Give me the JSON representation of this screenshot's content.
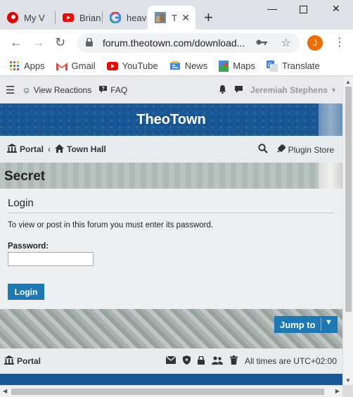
{
  "browser": {
    "tabs": [
      {
        "title": "My V",
        "icon": "vodafone-icon"
      },
      {
        "title": "Brian",
        "icon": "youtube-icon"
      },
      {
        "title": "heav",
        "icon": "google-icon"
      },
      {
        "title": "T",
        "icon": "theotown-icon",
        "active": true
      }
    ],
    "new_tab": "+",
    "url": "forum.theotown.com/download...",
    "profile_initial": "J",
    "bookmarks": [
      {
        "label": "Apps",
        "icon": "apps-grid-icon"
      },
      {
        "label": "Gmail",
        "icon": "gmail-icon"
      },
      {
        "label": "YouTube",
        "icon": "youtube-icon"
      },
      {
        "label": "News",
        "icon": "google-news-icon"
      },
      {
        "label": "Maps",
        "icon": "google-maps-icon"
      },
      {
        "label": "Translate",
        "icon": "google-translate-icon"
      }
    ]
  },
  "forum": {
    "nav": {
      "view_reactions": "View Reactions",
      "faq": "FAQ",
      "user": "Jeremiah Stephens"
    },
    "site_title": "TheoTown",
    "breadcrumb": {
      "portal": "Portal",
      "town_hall": "Town Hall",
      "plugin_store": "Plugin Store"
    },
    "page_title": "Secret",
    "login": {
      "heading": "Login",
      "message": "To view or post in this forum you must enter its password.",
      "password_label": "Password:",
      "password_value": "",
      "button": "Login"
    },
    "jump_to": "Jump to",
    "footer": {
      "portal": "Portal",
      "timezone": "All times are UTC+02:00"
    }
  },
  "colors": {
    "brand_blue": "#1a5796",
    "button_blue": "#1c79b6"
  }
}
